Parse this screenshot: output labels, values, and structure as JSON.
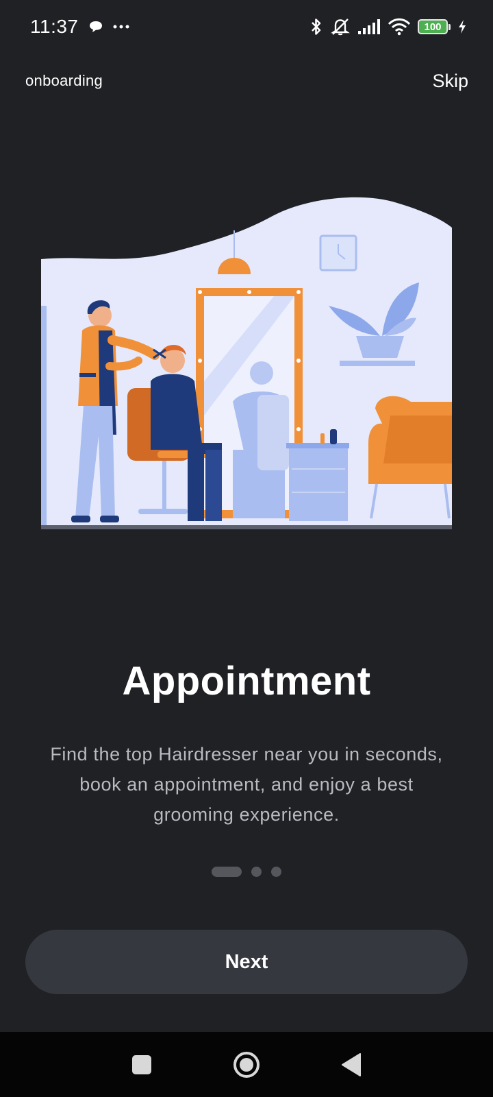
{
  "status_bar": {
    "time": "11:37",
    "battery_level": "100",
    "icons": [
      "chat-bubble-icon",
      "more-dots-icon",
      "bluetooth-icon",
      "silent-mode-icon",
      "signal-icon",
      "wifi-icon",
      "battery-icon",
      "charging-icon"
    ]
  },
  "header": {
    "title": "onboarding",
    "skip_label": "Skip"
  },
  "illustration": {
    "name": "barbershop-illustration",
    "colors": {
      "background": "#e5e9fb",
      "accent_orange": "#f0913a",
      "navy": "#1e3a7a",
      "light_blue": "#a9bdf0"
    }
  },
  "content": {
    "title": "Appointment",
    "description": "Find the top Hairdresser near you in seconds, book an appointment, and enjoy a best grooming experience."
  },
  "pager": {
    "page_count": 3,
    "active_index": 0
  },
  "actions": {
    "next_label": "Next"
  },
  "nav_bar": {
    "buttons": [
      "recents-square-icon",
      "home-circle-icon",
      "back-triangle-icon"
    ]
  },
  "theme": {
    "background": "#202125",
    "button": "#363840",
    "text_secondary": "#b9bbc1"
  }
}
